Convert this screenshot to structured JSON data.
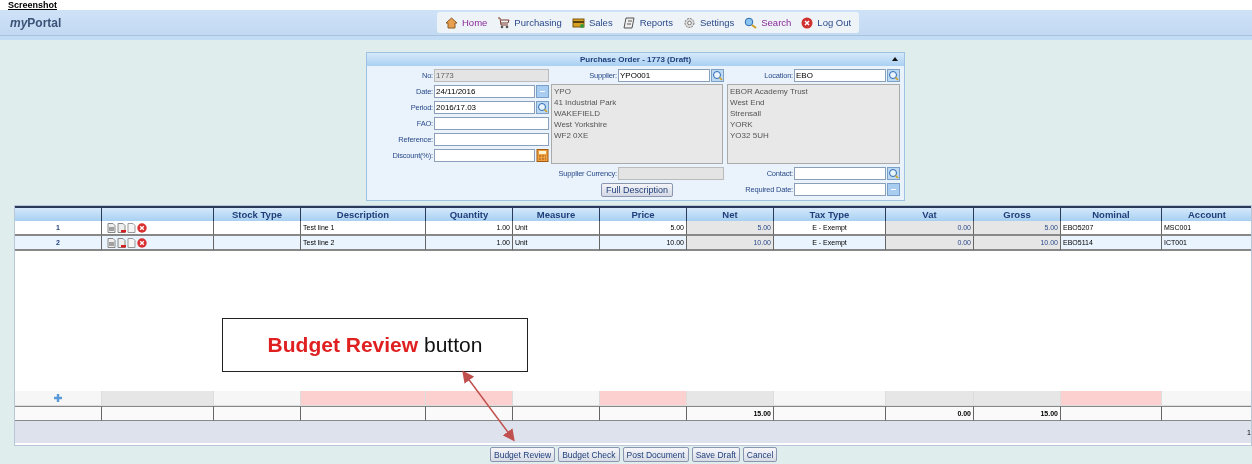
{
  "document_heading": "Screenshot",
  "app": {
    "logo_prefix": "my",
    "logo_name": "Portal"
  },
  "nav": [
    {
      "label": "Home",
      "visited": true
    },
    {
      "label": "Purchasing",
      "visited": false
    },
    {
      "label": "Sales",
      "visited": false
    },
    {
      "label": "Reports",
      "visited": false
    },
    {
      "label": "Settings",
      "visited": false
    },
    {
      "label": "Search",
      "visited": true
    },
    {
      "label": "Log Out",
      "visited": false
    }
  ],
  "form": {
    "title": "Purchase Order - 1773 (Draft)",
    "left_fields": [
      {
        "label": "No:",
        "value": "1773",
        "disabled": true,
        "kind": "plain"
      },
      {
        "label": "Date:",
        "value": "24/11/2016",
        "disabled": false,
        "kind": "calendar"
      },
      {
        "label": "Period:",
        "value": "2016/17.03",
        "disabled": false,
        "kind": "search"
      },
      {
        "label": "FAO:",
        "disabled": false,
        "kind": "plain"
      },
      {
        "label": "Reference:",
        "disabled": false,
        "kind": "plain"
      },
      {
        "label": "Discount(%):",
        "disabled": false,
        "kind": "calculator"
      }
    ],
    "supplier": {
      "label": "Supplier:",
      "value": "YPO001"
    },
    "supplier_address": [
      "YPO",
      "41 Industrial Park",
      "WAKEFIELD",
      "West Yorkshire",
      "WF2 0XE"
    ],
    "supplier_currency": {
      "label": "Supplier Currency:",
      "disabled": true
    },
    "full_description_button": "Full Description",
    "location": {
      "label": "Location:",
      "value": "EBO"
    },
    "location_address": [
      "EBOR Academy Trust",
      "West End",
      "Strensall",
      "YORK",
      "YO32 5UH"
    ],
    "contact": {
      "label": "Contact:"
    },
    "required_date": {
      "label": "Required Date:"
    }
  },
  "grid": {
    "columns": [
      {},
      {},
      {
        "label": "Stock Type"
      },
      {
        "label": "Description"
      },
      {
        "label": "Quantity"
      },
      {
        "label": "Measure"
      },
      {
        "label": "Price"
      },
      {
        "label": "Net"
      },
      {
        "label": "Tax Type"
      },
      {
        "label": "Vat"
      },
      {
        "label": "Gross"
      },
      {
        "label": "Nominal"
      },
      {
        "label": "Account"
      }
    ],
    "rows": [
      {
        "number": "1",
        "description": "Test line 1",
        "quantity": "1.00",
        "measure": "Unit",
        "price": "5.00",
        "net": "5.00",
        "tax_type": "E - Exempt",
        "vat": "0.00",
        "gross": "5.00",
        "nominal": "EBO5207",
        "account": "MSC001"
      },
      {
        "number": "2",
        "description": "Test line 2",
        "quantity": "1.00",
        "measure": "Unit",
        "price": "10.00",
        "net": "10.00",
        "tax_type": "E - Exempt",
        "vat": "0.00",
        "gross": "10.00",
        "nominal": "EBO5114",
        "account": "ICT001"
      }
    ],
    "new_row": [
      {
        "kind": "add"
      },
      {
        "kind": "readonly"
      },
      {
        "kind": "plain"
      },
      {
        "kind": "required"
      },
      {
        "kind": "required"
      },
      {
        "kind": "plain"
      },
      {
        "kind": "required"
      },
      {
        "kind": "readonly"
      },
      {
        "kind": "plain"
      },
      {
        "kind": "readonly"
      },
      {
        "kind": "readonly"
      },
      {
        "kind": "required"
      },
      {
        "kind": "plain"
      }
    ],
    "totals": {
      "net": "15.00",
      "vat": "0.00",
      "gross": "15.00"
    },
    "pager": "1"
  },
  "actions": [
    "Budget Review",
    "Budget Check",
    "Post Document",
    "Save Draft",
    "Cancel"
  ],
  "callout": {
    "text": "**Budget Review** button"
  }
}
